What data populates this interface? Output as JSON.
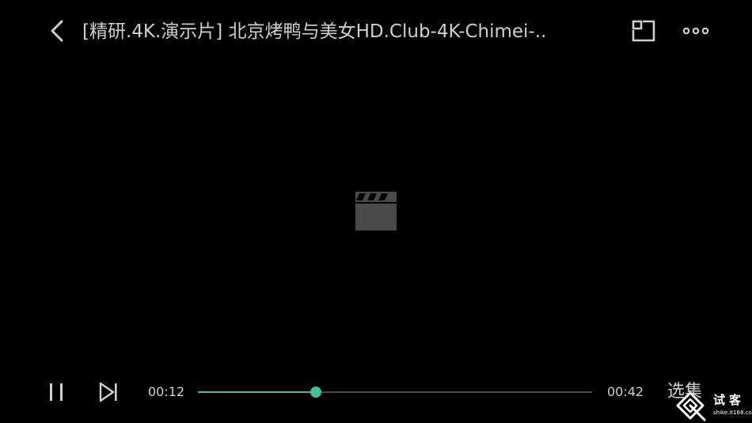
{
  "header": {
    "back_icon": "chevron-left-icon",
    "title": "[精研.4K.演示片] 北京烤鸭与美女HD.Club-4K-Chimei-..",
    "pip_icon": "picture-in-picture-icon",
    "more_icon": "more-horizontal-icon"
  },
  "video": {
    "placeholder_icon": "clapperboard-icon"
  },
  "controls": {
    "pause_icon": "pause-icon",
    "next_icon": "skip-next-icon",
    "current_time": "00:12",
    "total_time": "00:42",
    "progress": 0.3,
    "episodes_label": "选集"
  },
  "watermark": {
    "name": "试客",
    "site": "shike.it168.com"
  },
  "colors": {
    "background": "#000000",
    "accent": "#3fc09a",
    "text": "#cfcfcf",
    "track": "#4a4a4a"
  }
}
